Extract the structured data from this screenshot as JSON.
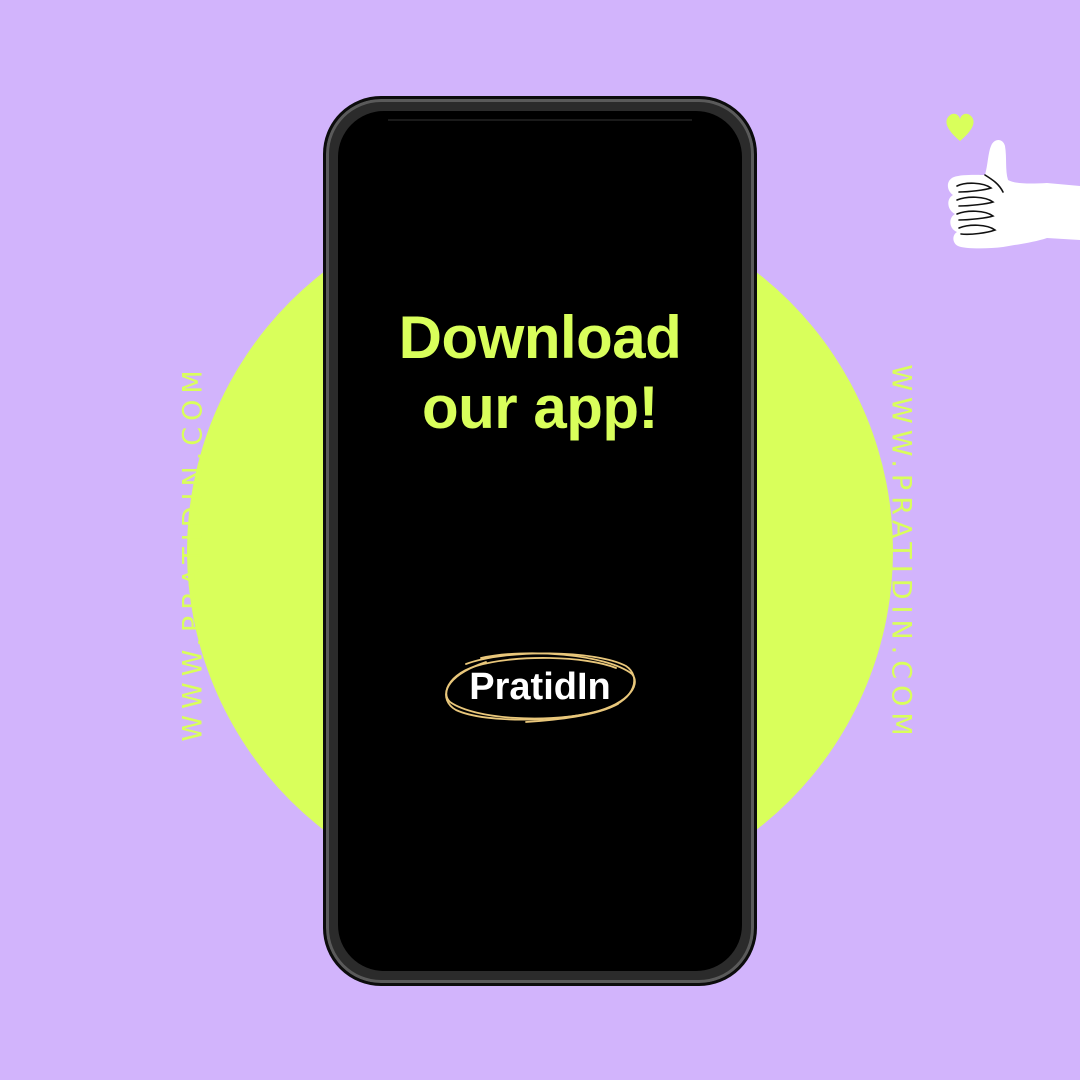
{
  "colors": {
    "background": "#D2B4FC",
    "circle": "#D9FF5B",
    "accent_text": "#D9FF5B",
    "phone_screen": "#000000",
    "brand_text": "#FFFFFF",
    "brand_scribble": "#E9C77B",
    "hand": "#FFFFFF",
    "heart": "#D9FF5B"
  },
  "side_text_left": "WWW.PRATIDIN.COM",
  "side_text_right": "WWW.PRATIDIN.COM",
  "phone": {
    "headline_line1": "Download",
    "headline_line2": "our app!",
    "brand_name": "PratidIn"
  },
  "icons": {
    "thumb": "thumbs-up-hand-icon",
    "heart": "heart-icon",
    "scribble": "scribble-circle-icon"
  }
}
